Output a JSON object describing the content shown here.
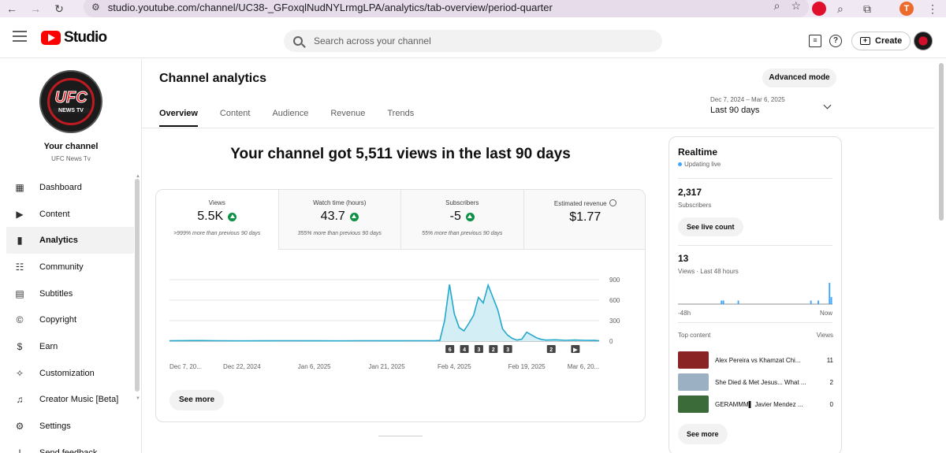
{
  "browser": {
    "url": "studio.youtube.com/channel/UC38-_GFoxqlNudNYLrmgLPA/analytics/tab-overview/period-quarter",
    "profile_initial": "T"
  },
  "header": {
    "logo_text": "Studio",
    "search_placeholder": "Search across your channel",
    "create_label": "Create"
  },
  "sidebar": {
    "your_channel": "Your channel",
    "channel_name": "UFC News Tv",
    "avatar_text_main": "UFC",
    "avatar_text_sub": "NEWS TV",
    "items": [
      {
        "label": "Dashboard",
        "icon": "dashboard-icon",
        "glyph": "▦"
      },
      {
        "label": "Content",
        "icon": "content-icon",
        "glyph": "▶"
      },
      {
        "label": "Analytics",
        "icon": "analytics-icon",
        "glyph": "▮"
      },
      {
        "label": "Community",
        "icon": "community-icon",
        "glyph": "☷"
      },
      {
        "label": "Subtitles",
        "icon": "subtitles-icon",
        "glyph": "▤"
      },
      {
        "label": "Copyright",
        "icon": "copyright-icon",
        "glyph": "©"
      },
      {
        "label": "Earn",
        "icon": "earn-icon",
        "glyph": "$"
      },
      {
        "label": "Customization",
        "icon": "customization-icon",
        "glyph": "✧"
      },
      {
        "label": "Creator Music [Beta]",
        "icon": "creator-music-icon",
        "glyph": "♫"
      },
      {
        "label": "Settings",
        "icon": "settings-icon",
        "glyph": "⚙"
      },
      {
        "label": "Send feedback",
        "icon": "feedback-icon",
        "glyph": "!"
      }
    ]
  },
  "main": {
    "title": "Channel analytics",
    "advanced_mode": "Advanced mode",
    "tabs": [
      "Overview",
      "Content",
      "Audience",
      "Revenue",
      "Trends"
    ],
    "period_range": "Dec 7, 2024 – Mar 6, 2025",
    "period_label": "Last 90 days",
    "headline": "Your channel got 5,511 views in the last 90 days",
    "metrics": [
      {
        "label": "Views",
        "value": "5.5K",
        "sub": ">999% more than previous 90 days"
      },
      {
        "label": "Watch time (hours)",
        "value": "43.7",
        "sub": "355% more than previous 90 days"
      },
      {
        "label": "Subscribers",
        "value": "-5",
        "sub": "55% more than previous 90 days"
      },
      {
        "label": "Estimated revenue",
        "value": "$1.77"
      }
    ],
    "see_more": "See more"
  },
  "chart_data": {
    "type": "area",
    "series_color": "#23a8cc",
    "ylim": [
      0,
      900
    ],
    "y_ticks": [
      "0",
      "300",
      "600",
      "900"
    ],
    "x_tick_labels": [
      "Dec 7, 20...",
      "Dec 22, 2024",
      "Jan 6, 2025",
      "Jan 21, 2025",
      "Feb 4, 2025",
      "Feb 19, 2025",
      "Mar 6, 20..."
    ],
    "x_tick_days": [
      0,
      15,
      30,
      45,
      59,
      74,
      89
    ],
    "points": [
      [
        0,
        5
      ],
      [
        5,
        8
      ],
      [
        10,
        6
      ],
      [
        15,
        4
      ],
      [
        20,
        5
      ],
      [
        25,
        6
      ],
      [
        30,
        5
      ],
      [
        35,
        4
      ],
      [
        40,
        6
      ],
      [
        45,
        5
      ],
      [
        50,
        6
      ],
      [
        55,
        5
      ],
      [
        56,
        10
      ],
      [
        57,
        300
      ],
      [
        58,
        830
      ],
      [
        59,
        400
      ],
      [
        60,
        200
      ],
      [
        61,
        150
      ],
      [
        62,
        260
      ],
      [
        63,
        380
      ],
      [
        64,
        640
      ],
      [
        65,
        560
      ],
      [
        66,
        820
      ],
      [
        67,
        640
      ],
      [
        68,
        460
      ],
      [
        69,
        180
      ],
      [
        70,
        90
      ],
      [
        71,
        40
      ],
      [
        72,
        15
      ],
      [
        73,
        30
      ],
      [
        74,
        130
      ],
      [
        75,
        90
      ],
      [
        76,
        50
      ],
      [
        77,
        25
      ],
      [
        78,
        15
      ],
      [
        80,
        20
      ],
      [
        82,
        12
      ],
      [
        84,
        16
      ],
      [
        86,
        12
      ],
      [
        88,
        10
      ],
      [
        89,
        5
      ]
    ],
    "markers": [
      {
        "day": 58,
        "label": "6"
      },
      {
        "day": 61,
        "label": "4"
      },
      {
        "day": 64,
        "label": "3"
      },
      {
        "day": 67,
        "label": "2"
      },
      {
        "day": 70,
        "label": "3"
      },
      {
        "day": 79,
        "label": "2"
      },
      {
        "day": 84,
        "label": "▶"
      }
    ]
  },
  "realtime": {
    "title": "Realtime",
    "status": "Updating live",
    "subscribers": "2,317",
    "subscribers_label": "Subscribers",
    "live_count_btn": "See live count",
    "views": "13",
    "views_label": "Views · Last 48 hours",
    "axis_left": "-48h",
    "axis_right": "Now",
    "bars": [
      0,
      0,
      0,
      0,
      0,
      0,
      0,
      0,
      0,
      0,
      0,
      0,
      0,
      0,
      0,
      0,
      0,
      0,
      0,
      0,
      0,
      0,
      0,
      1,
      1,
      0,
      0,
      0,
      0,
      0,
      0,
      0,
      1,
      0,
      0,
      0,
      0,
      0,
      0,
      0,
      0,
      0,
      0,
      0,
      0,
      0,
      0,
      0,
      0,
      0,
      0,
      0,
      0,
      0,
      0,
      0,
      0,
      0,
      0,
      0,
      0,
      0,
      0,
      0,
      0,
      0,
      0,
      0,
      0,
      0,
      0,
      1,
      0,
      0,
      0,
      1,
      0,
      0,
      0,
      0,
      0,
      6,
      2
    ],
    "top_content_label": "Top content",
    "views_col_label": "Views",
    "top_content": [
      {
        "title": "Alex Pereira vs Khamzat Chi...",
        "views": "11",
        "thumb": "#8a2323"
      },
      {
        "title": "She Died & Met Jesus... What ...",
        "views": "2",
        "thumb": "#9cb0c4"
      },
      {
        "title": "GERAMMM▌ Javier Mendez ...",
        "views": "0",
        "thumb": "#3c6b3a"
      }
    ],
    "see_more": "See more"
  }
}
